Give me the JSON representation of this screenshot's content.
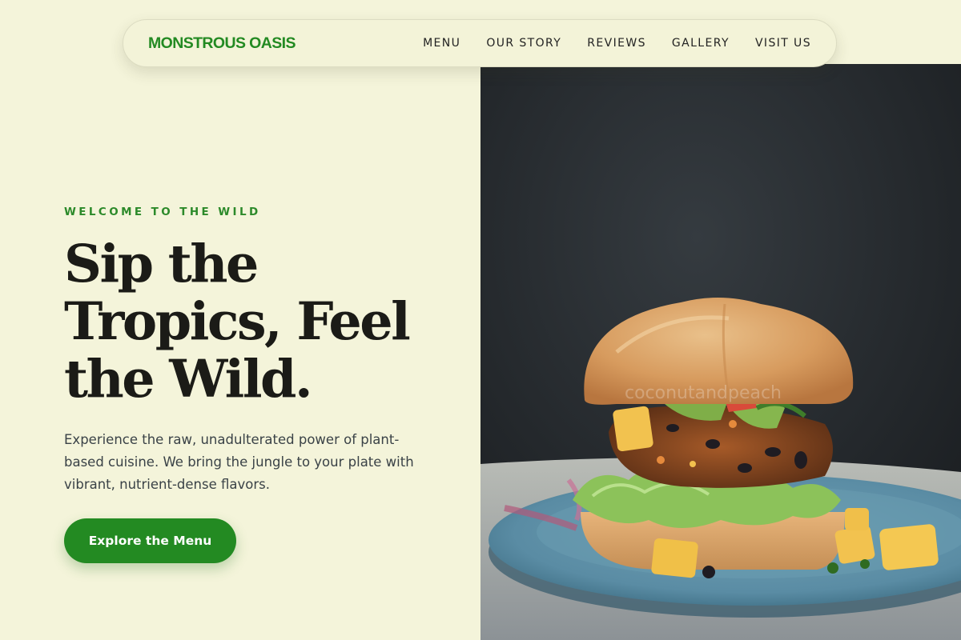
{
  "brand": {
    "name": "MONSTROUS OASIS",
    "color": "#238a22"
  },
  "nav": {
    "items": [
      {
        "label": "MENU"
      },
      {
        "label": "OUR STORY"
      },
      {
        "label": "REVIEWS"
      },
      {
        "label": "GALLERY"
      },
      {
        "label": "VISIT US"
      }
    ]
  },
  "hero": {
    "eyebrow": "WELCOME TO THE WILD",
    "headline_lines": [
      "Sip the",
      "Tropics, Feel",
      "the Wild."
    ],
    "description": "Experience the raw, unadulterated power of plant-based cuisine. We bring the jungle to your plate with vibrant, nutrient-dense flavors.",
    "cta_label": "Explore the Menu",
    "image_subject": "veggie-burger-photo",
    "image_watermark": "coconutandpeach"
  },
  "colors": {
    "background": "#f4f4da",
    "accent": "#238a22",
    "heading": "#1b1b17",
    "body_text": "#3a4247"
  }
}
